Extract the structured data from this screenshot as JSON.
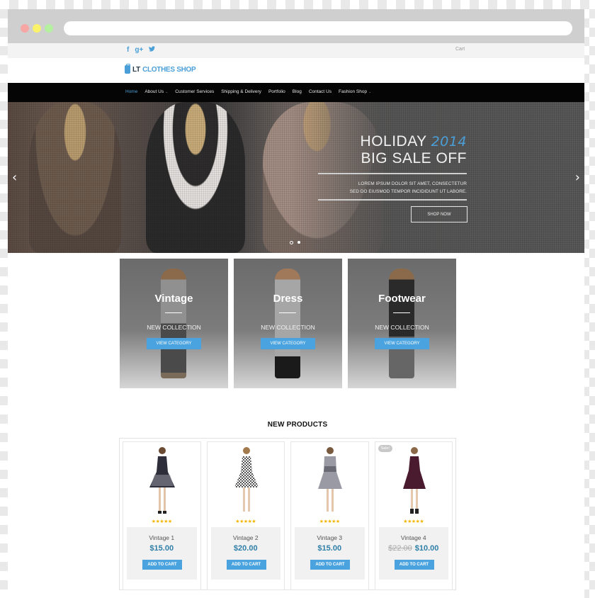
{
  "browser": {
    "window_buttons": [
      "close",
      "minimize",
      "maximize"
    ],
    "url": ""
  },
  "topbar": {
    "social": [
      {
        "icon": "facebook-icon",
        "glyph": "f"
      },
      {
        "icon": "google-plus-icon",
        "glyph": "g+"
      },
      {
        "icon": "twitter-icon",
        "glyph": "t"
      }
    ],
    "cart_label": "Cart"
  },
  "logo": {
    "prefix": "LT",
    "name": "CLOTHES SHOP"
  },
  "nav": {
    "items": [
      {
        "label": "Home",
        "active": true,
        "dropdown": false
      },
      {
        "label": "About Us",
        "active": false,
        "dropdown": true
      },
      {
        "label": "Customer Services",
        "active": false,
        "dropdown": false
      },
      {
        "label": "Shipping & Delivery",
        "active": false,
        "dropdown": false
      },
      {
        "label": "Portfolio",
        "active": false,
        "dropdown": false
      },
      {
        "label": "Blog",
        "active": false,
        "dropdown": false
      },
      {
        "label": "Contact Us",
        "active": false,
        "dropdown": false
      },
      {
        "label": "Fashion Shop",
        "active": false,
        "dropdown": true
      }
    ],
    "caret": "⌄"
  },
  "hero": {
    "line1": "HOLIDAY",
    "year": "2014",
    "line2": "BIG SALE OFF",
    "lorem1": "LOREM IPSUM DOLOR SIT AMET, CONSECTETUR",
    "lorem2": "SED DO EIUSMOD TEMPOR INCIDIDUNT UT LABORE.",
    "button": "SHOP NOW",
    "prev": "‹",
    "next": "›",
    "slides": 2,
    "active_slide": 1
  },
  "categories": [
    {
      "title": "Vintage",
      "subtitle": "NEW COLLECTION",
      "button": "VIEW CATEGORY"
    },
    {
      "title": "Dress",
      "subtitle": "NEW COLLECTION",
      "button": "VIEW CATEGORY"
    },
    {
      "title": "Footwear",
      "subtitle": "NEW COLLECTION",
      "button": "VIEW CATEGORY"
    }
  ],
  "new_products": {
    "title": "NEW PRODUCTS",
    "items": [
      {
        "name": "Vintage 1",
        "price": "$15.00",
        "old_price": null,
        "stars": "★★★★★",
        "rating": 5,
        "button": "ADD TO CART",
        "badge": null
      },
      {
        "name": "Vintage 2",
        "price": "$20.00",
        "old_price": null,
        "stars": "★★★★★",
        "rating": 5,
        "button": "ADD TO CART",
        "badge": null
      },
      {
        "name": "Vintage 3",
        "price": "$15.00",
        "old_price": null,
        "stars": "★★★★★",
        "rating": 5,
        "button": "ADD TO CART",
        "badge": null
      },
      {
        "name": "Vintage 4",
        "price": "$10.00",
        "old_price": "$22.00",
        "stars": "★★★★★",
        "rating": 5,
        "button": "ADD TO CART",
        "badge": "Sale!"
      }
    ]
  },
  "colors": {
    "accent": "#4aa3df",
    "price": "#2f7fa8",
    "nav_bg": "#050505",
    "star": "#f5b400"
  }
}
